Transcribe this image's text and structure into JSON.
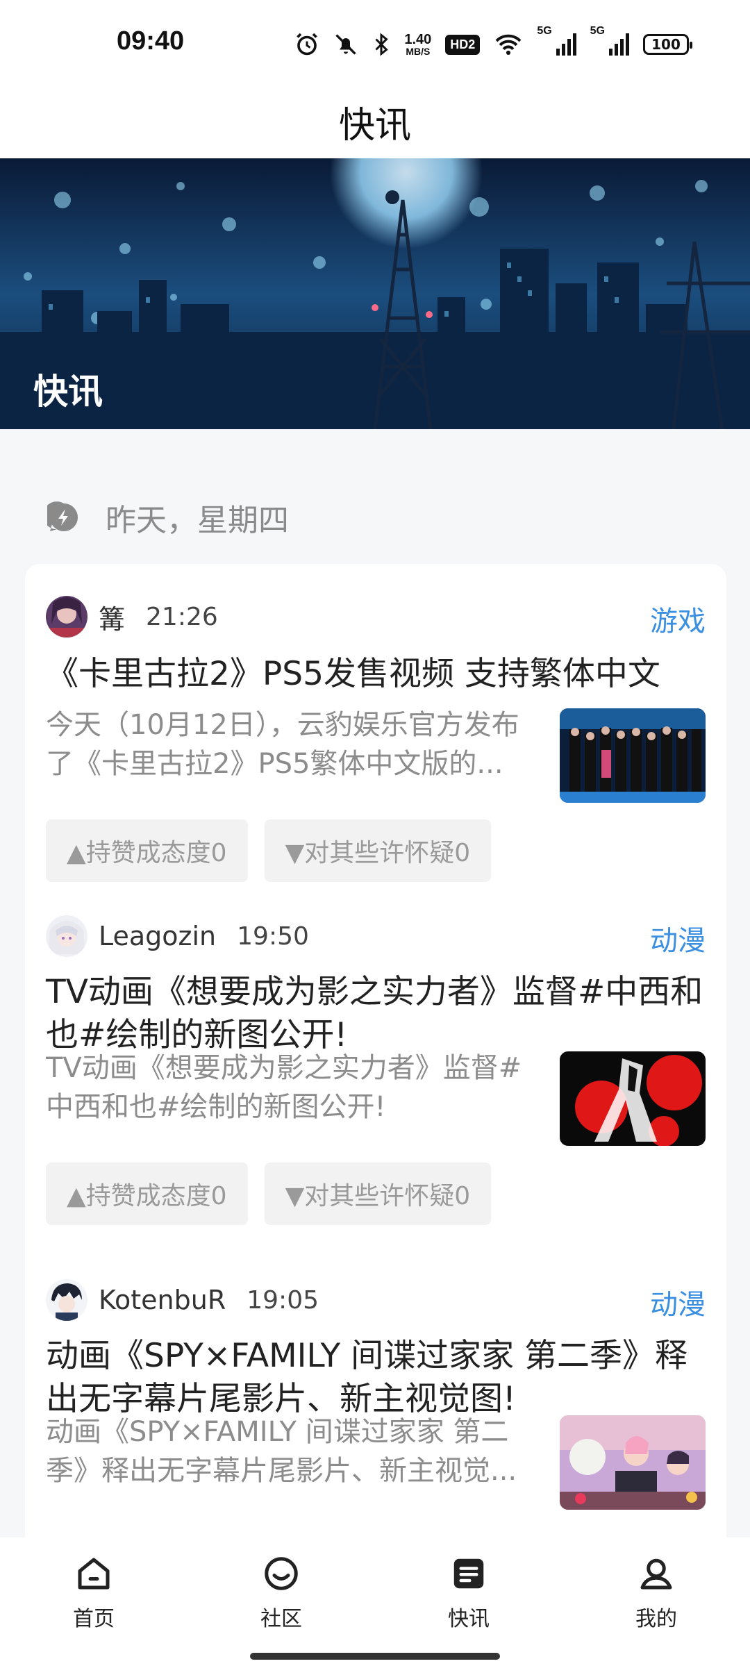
{
  "status_bar": {
    "time": "09:40",
    "net_speed_value": "1.40",
    "net_speed_unit": "MB/S",
    "hd_label": "HD2",
    "sim1_label": "5G",
    "sim2_label": "5G",
    "battery": "100"
  },
  "header": {
    "title": "快讯"
  },
  "banner": {
    "title": "快讯"
  },
  "date_section": {
    "label": "昨天，星期四"
  },
  "news": [
    {
      "author": "篝",
      "time": "21:26",
      "category": "游戏",
      "headline": "《卡里古拉2》PS5发售视频 支持繁体中文",
      "summary": "今天（10月12日），云豹娱乐官方发布了《卡里古拉2》PS5繁体中文版的...",
      "upvote_label": "▲持赞成态度0",
      "downvote_label": "▼对其些许怀疑0"
    },
    {
      "author": "Leagozin",
      "time": "19:50",
      "category": "动漫",
      "headline": "TV动画《想要成为影之实力者》监督#中西和也#绘制的新图公开!",
      "summary": "TV动画《想要成为影之实力者》监督#中西和也#绘制的新图公开!",
      "upvote_label": "▲持赞成态度0",
      "downvote_label": "▼对其些许怀疑0"
    },
    {
      "author": "KotenbuR",
      "time": "19:05",
      "category": "动漫",
      "headline": "动画《SPY×FAMILY 间谍过家家 第二季》释出无字幕片尾影片、新主视觉图!",
      "summary": "动画《SPY×FAMILY 间谍过家家 第二季》释出无字幕片尾影片、新主视觉..."
    }
  ],
  "bottom_nav": {
    "items": [
      {
        "label": "首页",
        "icon": "home-icon"
      },
      {
        "label": "社区",
        "icon": "community-icon"
      },
      {
        "label": "快讯",
        "icon": "news-icon",
        "active": true
      },
      {
        "label": "我的",
        "icon": "profile-icon"
      }
    ]
  },
  "colors": {
    "accent": "#3b8fe0",
    "muted_text": "#8c8c8c",
    "vote_bg": "#f2f2f2"
  }
}
